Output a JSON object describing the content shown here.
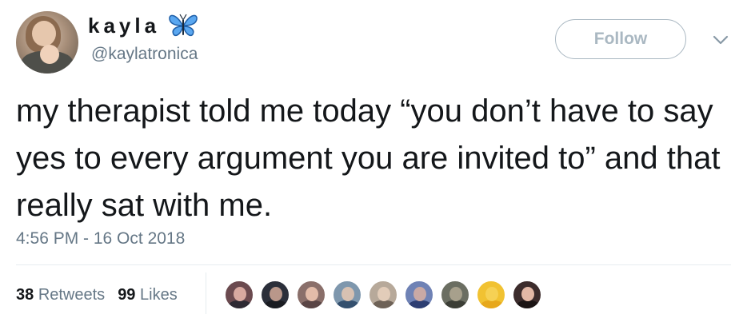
{
  "user": {
    "display_name": "kayla",
    "handle": "@kaylatronica",
    "emoji": "butterfly"
  },
  "follow_button": {
    "label": "Follow"
  },
  "tweet": {
    "text": "my therapist told me today “you don’t have to say yes to every argument you are invited to” and that really sat with me.",
    "timestamp": "4:56 PM - 16 Oct 2018"
  },
  "stats": {
    "retweets_count": "38",
    "retweets_label": "Retweets",
    "likes_count": "99",
    "likes_label": "Likes"
  },
  "colors": {
    "text": "#14171a",
    "secondary": "#657786",
    "border": "#e6ecf0",
    "follow_border": "#aab8c2",
    "butterfly": "#3b8fe8"
  },
  "likers": [
    {
      "name": "liker-avatar-1",
      "bg": "#6b4a4f",
      "face": "#d8a9a0",
      "body": "#2e2a33"
    },
    {
      "name": "liker-avatar-2",
      "bg": "#2b2f3a",
      "face": "#b9978a",
      "body": "#1a1c22"
    },
    {
      "name": "liker-avatar-3",
      "bg": "#8a6f6a",
      "face": "#e3bca9",
      "body": "#5a4545"
    },
    {
      "name": "liker-avatar-4",
      "bg": "#7e97ad",
      "face": "#d7c1b2",
      "body": "#34506e"
    },
    {
      "name": "liker-avatar-5",
      "bg": "#b7a99a",
      "face": "#e2ccb9",
      "body": "#6e6257"
    },
    {
      "name": "liker-avatar-6",
      "bg": "#6f82b5",
      "face": "#c9a9a5",
      "body": "#2d3e72"
    },
    {
      "name": "liker-avatar-7",
      "bg": "#6b6e62",
      "face": "#a7a08c",
      "body": "#3c3e36"
    },
    {
      "name": "liker-avatar-8",
      "bg": "#f1c232",
      "face": "#f6d154",
      "body": "#e7a81c"
    },
    {
      "name": "liker-avatar-9",
      "bg": "#3c2c2c",
      "face": "#e3b8a6",
      "body": "#1b1414"
    }
  ]
}
